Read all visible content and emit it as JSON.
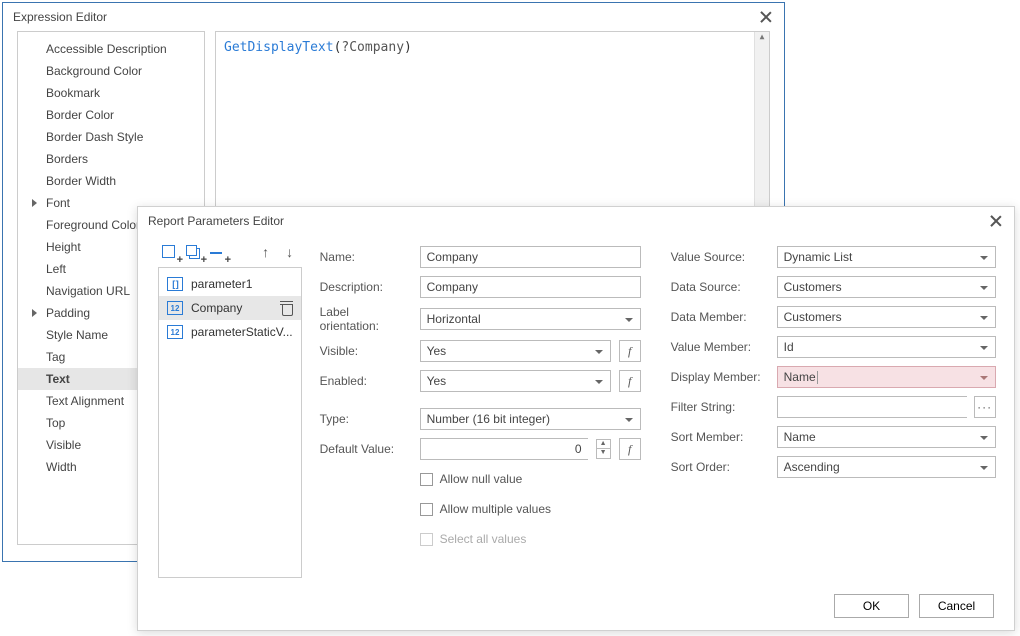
{
  "expression_editor": {
    "title": "Expression Editor",
    "properties": [
      "Accessible Description",
      "Background Color",
      "Bookmark",
      "Border Color",
      "Border Dash Style",
      "Borders",
      "Border Width",
      "Font",
      "Foreground Color",
      "Height",
      "Left",
      "Navigation URL",
      "Padding",
      "Style Name",
      "Tag",
      "Text",
      "Text Alignment",
      "Top",
      "Visible",
      "Width"
    ],
    "expandable": [
      "Font",
      "Padding"
    ],
    "selected_property": "Text",
    "expression_fn": "GetDisplayText",
    "expression_arg": "?Company"
  },
  "report_parameters": {
    "title": "Report Parameters Editor",
    "parameters": [
      {
        "name": "parameter1",
        "icon": "bracket"
      },
      {
        "name": "Company",
        "icon": "num"
      },
      {
        "name": "parameterStaticV...",
        "icon": "num"
      }
    ],
    "selected_parameter": 1,
    "left_fields": {
      "name_label": "Name:",
      "name": "Company",
      "desc_label": "Description:",
      "desc": "Company",
      "labelorient_label": "Label orientation:",
      "labelorient": "Horizontal",
      "visible_label": "Visible:",
      "visible": "Yes",
      "enabled_label": "Enabled:",
      "enabled": "Yes",
      "type_label": "Type:",
      "type": "Number (16 bit integer)",
      "default_label": "Default Value:",
      "default": "0",
      "allow_null": "Allow null value",
      "allow_multi": "Allow multiple values",
      "select_all": "Select all values"
    },
    "right_fields": {
      "vsource_label": "Value Source:",
      "vsource": "Dynamic List",
      "dsource_label": "Data Source:",
      "dsource": "Customers",
      "dmember_label": "Data Member:",
      "dmember": "Customers",
      "vmember_label": "Value Member:",
      "vmember": "Id",
      "dispmember_label": "Display Member:",
      "dispmember": "Name",
      "filter_label": "Filter String:",
      "filter": "",
      "sortmember_label": "Sort Member:",
      "sortmember": "Name",
      "sortorder_label": "Sort Order:",
      "sortorder": "Ascending"
    },
    "buttons": {
      "ok": "OK",
      "cancel": "Cancel"
    }
  }
}
